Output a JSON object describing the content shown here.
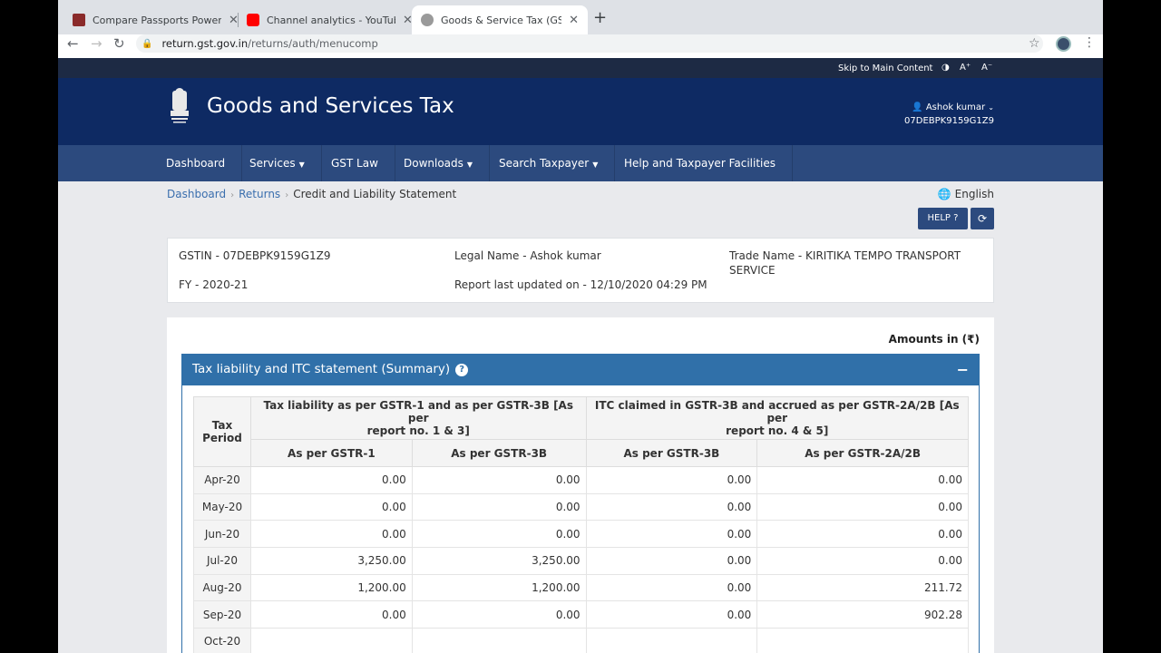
{
  "browser": {
    "tabs": [
      {
        "title": "Compare Passports Power | Pa",
        "color": "#8a2a2a"
      },
      {
        "title": "Channel analytics - YouTube St",
        "color": "#ff0000"
      },
      {
        "title": "Goods & Service Tax (GST) | U",
        "color": "#6b6b6b"
      }
    ],
    "url_host": "return.gst.gov.in",
    "url_path": "/returns/auth/menucomp"
  },
  "topbar": {
    "skip": "Skip to Main Content",
    "contrast": "◑",
    "a_plus": "A⁺",
    "a_minus": "A⁻"
  },
  "header": {
    "title": "Goods and Services Tax",
    "user_name": "Ashok kumar",
    "user_gstin": "07DEBPK9159G1Z9"
  },
  "nav": [
    {
      "label": "Dashboard",
      "caret": ""
    },
    {
      "label": "Services",
      "caret": "▼"
    },
    {
      "label": "GST Law",
      "caret": ""
    },
    {
      "label": "Downloads",
      "caret": "▼"
    },
    {
      "label": "Search Taxpayer",
      "caret": "▼"
    },
    {
      "label": "Help and Taxpayer Facilities",
      "caret": ""
    }
  ],
  "breadcrumb": {
    "dashboard": "Dashboard",
    "returns": "Returns",
    "current": "Credit and Liability Statement"
  },
  "language": "English",
  "buttons": {
    "help": "HELP"
  },
  "info": {
    "gstin": "GSTIN - 07DEBPK9159G1Z9",
    "legal_name": "Legal Name - Ashok kumar",
    "trade_name_1": "Trade Name - KIRITIKA TEMPO TRANSPORT",
    "trade_name_2": "SERVICE",
    "fy": "FY - 2020-21",
    "report_updated": "Report last updated on - 12/10/2020 04:29 PM"
  },
  "amounts_label": "Amounts in (₹)",
  "section_title": "Tax liability and ITC statement (Summary)",
  "table": {
    "h_period_1": "Tax",
    "h_period_2": "Period",
    "h_liab_1": "Tax liability as per GSTR-1 and as per GSTR-3B [As per",
    "h_liab_2": "report no. 1 & 3]",
    "h_itc_1": "ITC claimed in GSTR-3B and accrued as per GSTR-2A/2B [As per",
    "h_itc_2": "report no. 4 & 5]",
    "sub": [
      "As per GSTR-1",
      "As per GSTR-3B",
      "As per GSTR-3B",
      "As per GSTR-2A/2B"
    ],
    "rows": [
      {
        "period": "Apr-20",
        "v": [
          "0.00",
          "0.00",
          "0.00",
          "0.00"
        ]
      },
      {
        "period": "May-20",
        "v": [
          "0.00",
          "0.00",
          "0.00",
          "0.00"
        ]
      },
      {
        "period": "Jun-20",
        "v": [
          "0.00",
          "0.00",
          "0.00",
          "0.00"
        ]
      },
      {
        "period": "Jul-20",
        "v": [
          "3,250.00",
          "3,250.00",
          "0.00",
          "0.00"
        ]
      },
      {
        "period": "Aug-20",
        "v": [
          "1,200.00",
          "1,200.00",
          "0.00",
          "211.72"
        ]
      },
      {
        "period": "Sep-20",
        "v": [
          "0.00",
          "0.00",
          "0.00",
          "902.28"
        ]
      },
      {
        "period": "Oct-20",
        "v": [
          "",
          "",
          "",
          ""
        ]
      }
    ]
  }
}
